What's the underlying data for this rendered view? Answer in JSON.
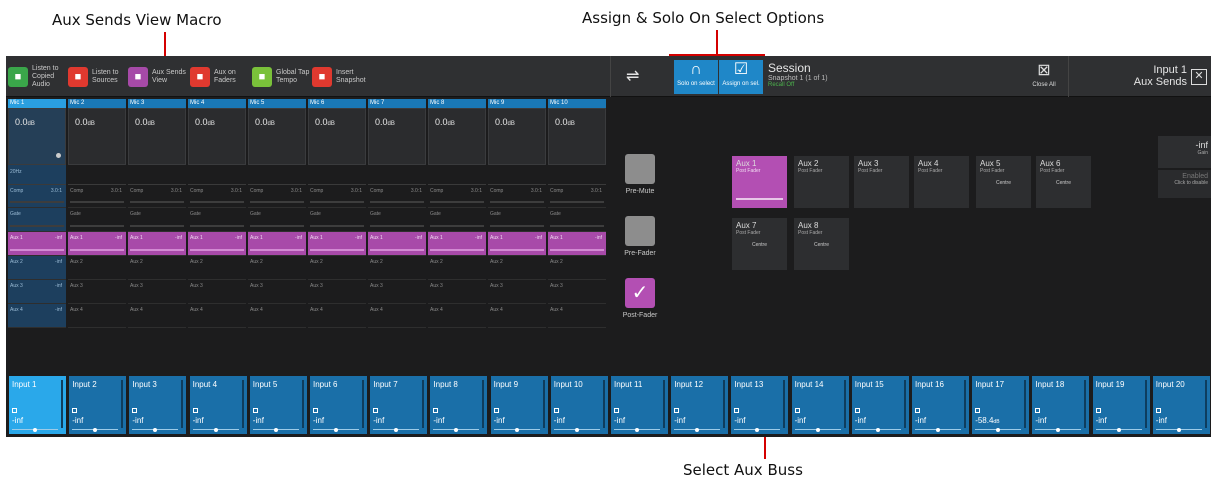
{
  "callouts": {
    "aux_sends_view_macro": "Aux Sends View Macro",
    "assign_solo": "Assign & Solo On Select Options",
    "select_aux_buss": "Select Aux Buss"
  },
  "toolbar": {
    "buttons": [
      {
        "label": "Listen to Copied Audio",
        "icon": "headphones-icon",
        "color": "#3aa64a"
      },
      {
        "label": "Listen to Sources",
        "icon": "listen-icon",
        "color": "#e0392f"
      },
      {
        "label": "Aux Sends View",
        "icon": "aux-sends-icon",
        "color": "#a64aa8"
      },
      {
        "label": "Aux on Faders",
        "icon": "faders-icon",
        "color": "#e0392f"
      },
      {
        "label": "Global Tap Tempo",
        "icon": "tap-tempo-icon",
        "color": "#7ac13a"
      },
      {
        "label": "Insert Snapshot",
        "icon": "snapshot-icon",
        "color": "#e0392f"
      }
    ],
    "solo_on_select": "Solo on select",
    "assign_on_select": "Assign on sel.",
    "session_title": "Session",
    "session_sub": "Snapshot 1 (1 of 1)",
    "session_status": "Recall Off",
    "close_all": "Close All",
    "aux_title_line1": "Input 1",
    "aux_title_line2": "Aux Sends",
    "close_symbol": "✕"
  },
  "strips": {
    "gain_value": "0.0",
    "gain_unit": "dB",
    "hpf_label": "20Hz",
    "comp_label": "Comp",
    "comp_ratio": "3.0:1",
    "gate_label": "Gate",
    "aux1_label": "Aux 1",
    "aux1_value": "-inf",
    "aux2_label": "Aux 2",
    "aux3_label": "Aux 3",
    "aux4_label": "Aux 4",
    "names": [
      "Mic 1",
      "Mic 2",
      "Mic 3",
      "Mic 4",
      "Mic 5",
      "Mic 6",
      "Mic 7",
      "Mic 8",
      "Mic 9",
      "Mic 10"
    ]
  },
  "send_points": {
    "pre_mute": "Pre-Mute",
    "pre_fader": "Pre-Fader",
    "post_fader": "Post-Fader",
    "check": "✓"
  },
  "aux_tiles": [
    {
      "name": "Aux 1",
      "mode": "Post Fader",
      "pan": ""
    },
    {
      "name": "Aux 2",
      "mode": "Post Fader",
      "pan": ""
    },
    {
      "name": "Aux 3",
      "mode": "Post Fader",
      "pan": ""
    },
    {
      "name": "Aux 4",
      "mode": "Post Fader",
      "pan": ""
    },
    {
      "name": "Aux 5",
      "mode": "Post Fader",
      "pan": "Centre"
    },
    {
      "name": "Aux 6",
      "mode": "Post Fader",
      "pan": "Centre"
    },
    {
      "name": "Aux 7",
      "mode": "Post Fader",
      "pan": "Centre"
    },
    {
      "name": "Aux 8",
      "mode": "Post Fader",
      "pan": "Centre"
    }
  ],
  "gain_panel": {
    "value": "-inf",
    "label": "Gain",
    "enabled": "Enabled",
    "click_hint": "Click to disable"
  },
  "inputs": [
    {
      "name": "Input 1",
      "level": "-inf"
    },
    {
      "name": "Input 2",
      "level": "-inf"
    },
    {
      "name": "Input 3",
      "level": "-inf"
    },
    {
      "name": "Input 4",
      "level": "-inf"
    },
    {
      "name": "Input 5",
      "level": "-inf"
    },
    {
      "name": "Input 6",
      "level": "-inf"
    },
    {
      "name": "Input 7",
      "level": "-inf"
    },
    {
      "name": "Input 8",
      "level": "-inf"
    },
    {
      "name": "Input 9",
      "level": "-inf"
    },
    {
      "name": "Input 10",
      "level": "-inf"
    },
    {
      "name": "Input 11",
      "level": "-inf"
    },
    {
      "name": "Input 12",
      "level": "-inf"
    },
    {
      "name": "Input 13",
      "level": "-inf"
    },
    {
      "name": "Input 14",
      "level": "-inf"
    },
    {
      "name": "Input 15",
      "level": "-inf"
    },
    {
      "name": "Input 16",
      "level": "-inf"
    },
    {
      "name": "Input 17",
      "level": "-58.4"
    },
    {
      "name": "Input 18",
      "level": "-inf"
    },
    {
      "name": "Input 19",
      "level": "-inf"
    },
    {
      "name": "Input 20",
      "level": "-inf"
    }
  ],
  "input17_unit": "dB"
}
